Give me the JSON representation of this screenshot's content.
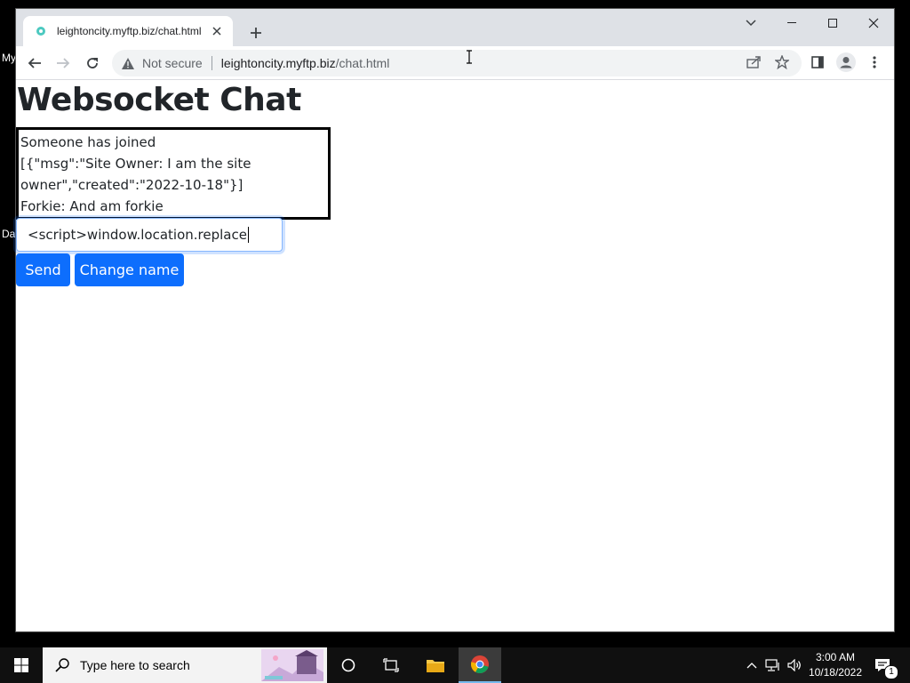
{
  "desktop": {
    "left_labels": [
      "My",
      "Da"
    ]
  },
  "browser": {
    "tab": {
      "title": "leightoncity.myftp.biz/chat.html"
    },
    "omnibox": {
      "security_label": "Not secure",
      "url_host": "leightoncity.myftp.biz",
      "url_path": "/chat.html"
    }
  },
  "page": {
    "heading": "Websocket Chat",
    "messages": [
      "Someone has joined",
      "[{\"msg\":\"Site Owner: I am the site owner\",\"created\":\"2022-10-18\"}]",
      "Forkie: And am forkie"
    ],
    "input_value": "<script>window.location.replace",
    "send_label": "Send",
    "change_name_label": "Change name"
  },
  "taskbar": {
    "search_placeholder": "Type here to search",
    "time": "3:00 AM",
    "date": "10/18/2022",
    "notification_count": "1"
  },
  "colors": {
    "primary": "#0d6efd",
    "tabstrip": "#dee1e6",
    "taskbar": "#101010"
  }
}
